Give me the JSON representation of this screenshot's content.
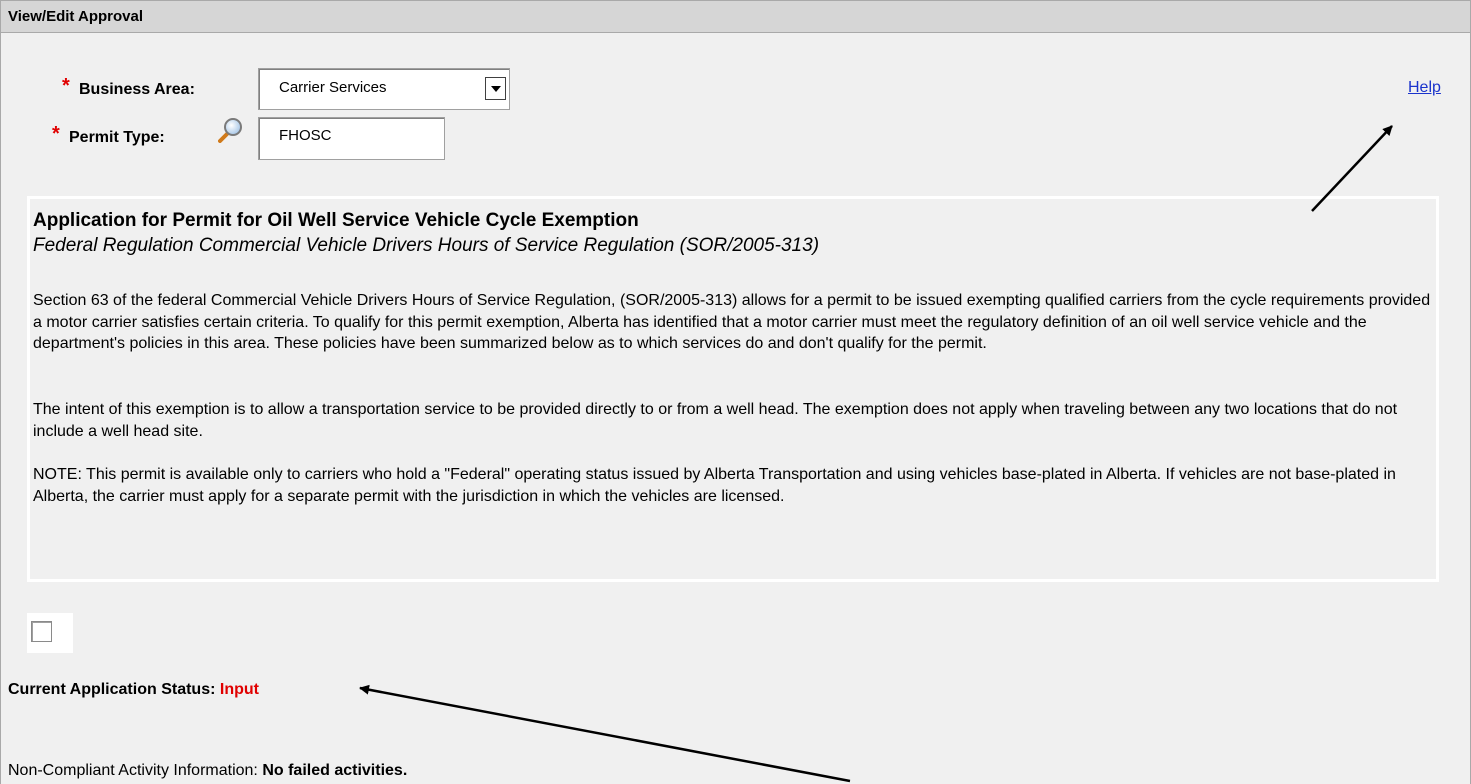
{
  "window": {
    "title": "View/Edit Approval"
  },
  "form": {
    "business_area": {
      "required_mark": "*",
      "label": "Business Area:",
      "value": "Carrier Services"
    },
    "permit_type": {
      "required_mark": "*",
      "label": "Permit Type:",
      "value": "FHOSC"
    },
    "help_link": "Help"
  },
  "info": {
    "title": "Application for Permit for Oil Well Service Vehicle Cycle Exemption",
    "subtitle": "Federal Regulation Commercial Vehicle Drivers Hours of Service Regulation (SOR/2005-313)",
    "paragraph1": "Section 63 of the federal Commercial Vehicle Drivers Hours of Service Regulation, (SOR/2005-313) allows for a permit to be issued exempting qualified carriers from the cycle requirements provided a motor carrier satisfies certain criteria. To qualify for this permit exemption, Alberta has identified that a motor carrier must meet the regulatory definition of an oil well service vehicle and the department's policies in this area. These policies have been summarized below as to which services do and don't qualify for the permit.",
    "paragraph2": "The intent of this exemption is to allow a transportation service to be provided directly to or from a well head. The exemption does not apply when traveling between any two locations that do not include a well head site.",
    "paragraph3": "NOTE: This permit is available only to carriers who hold a \"Federal\" operating status issued by Alberta Transportation and using vehicles base-plated in Alberta. If vehicles are not base-plated in Alberta, the carrier must apply for a separate permit with the jurisdiction in which the vehicles are licensed."
  },
  "status": {
    "label": "Current Application Status:",
    "value": "Input"
  },
  "non_compliant": {
    "label": "Non-Compliant Activity Information:",
    "value": "No failed activities."
  },
  "colors": {
    "required": "#e00000",
    "link": "#1a33cc",
    "header_bg": "#d6d6d6",
    "page_bg": "#f0f0f0"
  }
}
